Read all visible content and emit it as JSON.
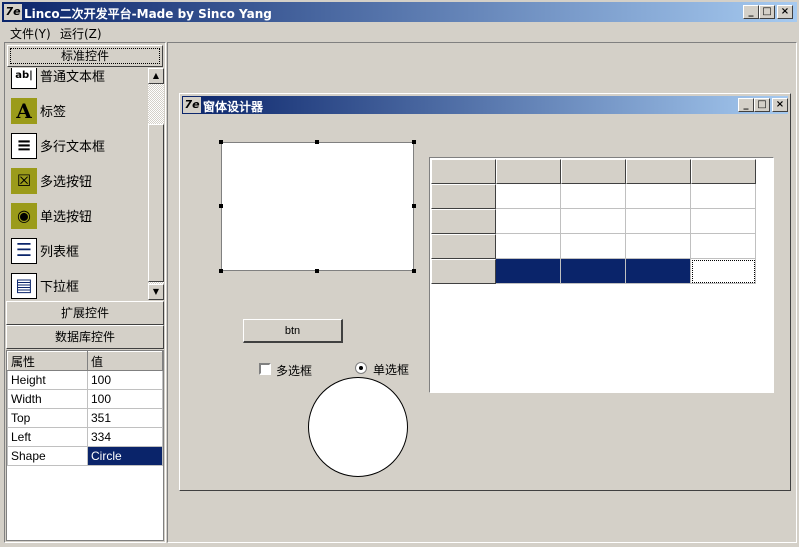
{
  "app": {
    "title": "Linco二次开发平台-Made by Sinco Yang",
    "icon_text": "7e",
    "controls": {
      "minimize": "_",
      "maximize": "□",
      "close": "×"
    }
  },
  "menu": [
    "文件(Y)",
    "运行(Z)"
  ],
  "toolbox": {
    "standard_label": "标准控件",
    "items": [
      {
        "label": "普通文本框",
        "icon": "ab|",
        "icon_name": "textbox-icon"
      },
      {
        "label": "标签",
        "icon": "A",
        "icon_name": "label-icon"
      },
      {
        "label": "多行文本框",
        "icon": "≡",
        "icon_name": "memo-icon"
      },
      {
        "label": "多选按钮",
        "icon": "☒",
        "icon_name": "checkbox-icon"
      },
      {
        "label": "单选按钮",
        "icon": "◉",
        "icon_name": "radio-icon"
      },
      {
        "label": "列表框",
        "icon": "☰",
        "icon_name": "listbox-icon"
      },
      {
        "label": "下拉框",
        "icon": "▤",
        "icon_name": "combobox-icon"
      }
    ],
    "extended_label": "扩展控件",
    "database_label": "数据库控件"
  },
  "properties": {
    "header_name": "属性",
    "header_value": "值",
    "rows": [
      {
        "name": "Height",
        "value": "100"
      },
      {
        "name": "Width",
        "value": "100"
      },
      {
        "name": "Top",
        "value": "351"
      },
      {
        "name": "Left",
        "value": "334"
      },
      {
        "name": "Shape",
        "value": "Circle"
      }
    ]
  },
  "designer": {
    "title": "窗体设计器",
    "icon_text": "7e",
    "button_label": "btn",
    "checkbox_label": "多选框",
    "radio_label": "单选框"
  },
  "colors": {
    "selection": "#0a246a",
    "face": "#d4d0c8",
    "olive_icon": "#9b9b1a"
  }
}
